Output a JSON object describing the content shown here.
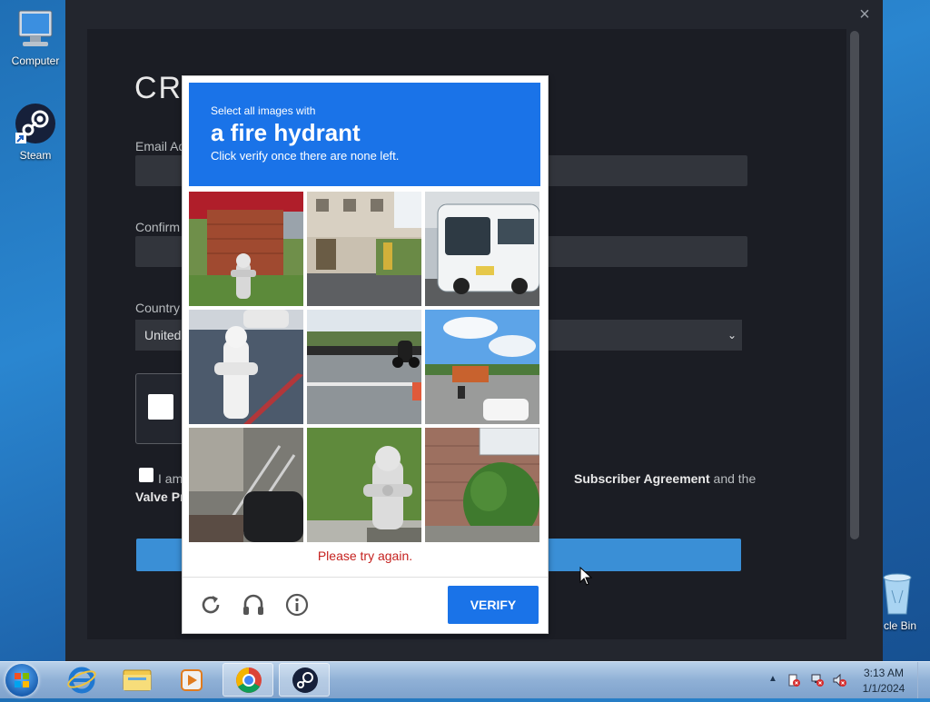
{
  "desktop": {
    "icons": [
      {
        "label": "Computer"
      },
      {
        "label": "Steam"
      },
      {
        "label": "cle Bin"
      }
    ]
  },
  "steam": {
    "close_glyph": "×",
    "title": "CR",
    "email_label": "Email Ad",
    "confirm_label": "Confirm",
    "country_label": "Country",
    "country_value": "United",
    "chevron": "⌄",
    "agree_prefix": "I am",
    "agree_link": "Subscriber Agreement",
    "agree_suffix": " and the",
    "privacy_link": "Valve Pr"
  },
  "captcha": {
    "prompt": "Select all images with",
    "target": "a fire hydrant",
    "instruction": "Click verify once there are none left.",
    "error": "Please try again.",
    "verify_label": "VERIFY",
    "icons": [
      "reload-icon",
      "audio-icon",
      "info-icon"
    ]
  },
  "taskbar": {
    "time": "3:13 AM",
    "date": "1/1/2024",
    "tray_arrow": "▲",
    "apps": [
      "internet-explorer-icon",
      "file-explorer-icon",
      "media-player-icon",
      "chrome-icon",
      "steam-icon"
    ]
  },
  "colors": {
    "captcha_blue": "#1a73e8",
    "error_red": "#c5221f",
    "steam_bg": "#1b1d24",
    "steam_button": "#3a8fd6"
  }
}
